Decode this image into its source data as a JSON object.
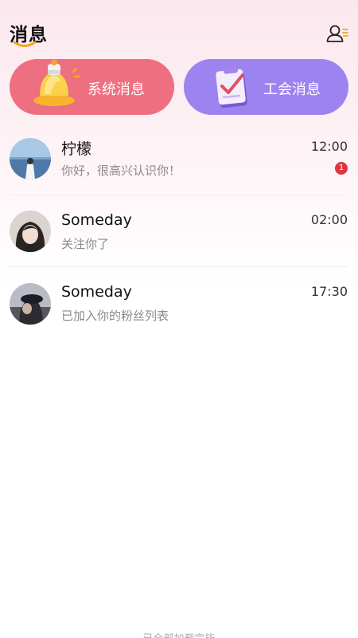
{
  "header": {
    "title": "消息",
    "profile_icon": "user-list-icon"
  },
  "cards": [
    {
      "label": "系统消息",
      "icon": "bell-icon",
      "color": "#ee6f80"
    },
    {
      "label": "工会消息",
      "icon": "clipboard-check-icon",
      "color": "#9c83f0"
    }
  ],
  "conversations": [
    {
      "name": "柠檬",
      "message": "你好，很高兴认识你！",
      "time": "12:00",
      "unread": "1"
    },
    {
      "name": "Someday",
      "message": "关注你了",
      "time": "02:00",
      "unread": ""
    },
    {
      "name": "Someday",
      "message": "已加入你的粉丝列表",
      "time": "17:30",
      "unread": ""
    }
  ],
  "footer": {
    "text": "已全部加载完毕"
  },
  "colors": {
    "accent_orange": "#f5a623",
    "badge_red": "#e0373f"
  }
}
